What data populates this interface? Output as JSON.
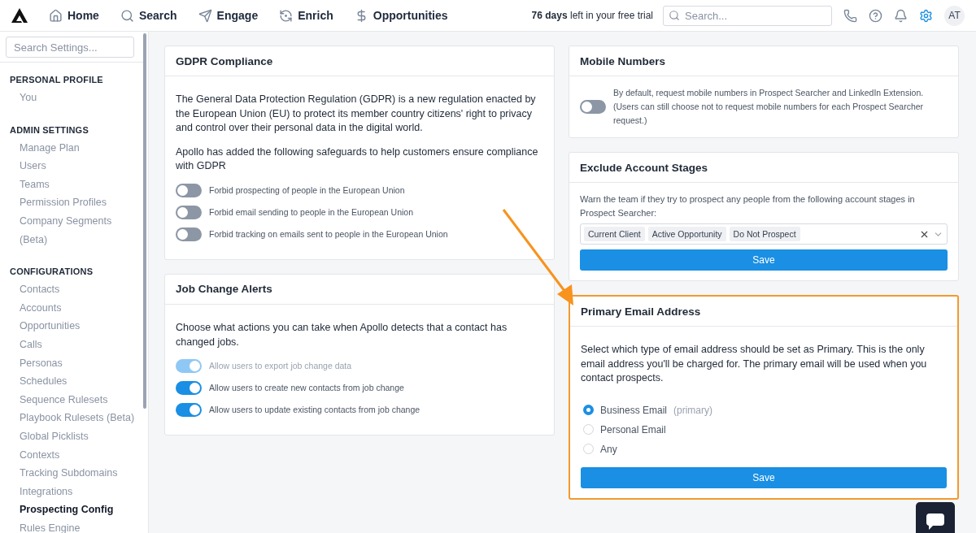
{
  "nav": {
    "items": [
      {
        "label": "Home"
      },
      {
        "label": "Search"
      },
      {
        "label": "Engage"
      },
      {
        "label": "Enrich"
      },
      {
        "label": "Opportunities"
      }
    ],
    "trial": "**76 days** left in your free trial",
    "search": {
      "placeholder": "Search..."
    },
    "settings_active": true,
    "avatar": "AT"
  },
  "sidebar": {
    "search": {
      "placeholder": "Search Settings..."
    },
    "sections": [
      {
        "heading": "PERSONAL PROFILE",
        "items": [
          {
            "label": "You",
            "selected": false
          }
        ]
      },
      {
        "heading": "ADMIN SETTINGS",
        "items": [
          {
            "label": "Manage Plan",
            "selected": false
          },
          {
            "label": "Users",
            "selected": false
          },
          {
            "label": "Teams",
            "selected": false
          },
          {
            "label": "Permission Profiles",
            "selected": false
          },
          {
            "label": "Company Segments (Beta)",
            "selected": false
          }
        ]
      },
      {
        "heading": "CONFIGURATIONS",
        "items": [
          {
            "label": "Contacts",
            "selected": false
          },
          {
            "label": "Accounts",
            "selected": false
          },
          {
            "label": "Opportunities",
            "selected": false
          },
          {
            "label": "Calls",
            "selected": false
          },
          {
            "label": "Personas",
            "selected": false
          },
          {
            "label": "Schedules",
            "selected": false
          },
          {
            "label": "Sequence Rulesets",
            "selected": false
          },
          {
            "label": "Playbook Rulesets (Beta)",
            "selected": false
          },
          {
            "label": "Global Picklists",
            "selected": false
          },
          {
            "label": "Contexts",
            "selected": false
          },
          {
            "label": "Tracking Subdomains",
            "selected": false
          },
          {
            "label": "Integrations",
            "selected": false
          },
          {
            "label": "Prospecting Config",
            "selected": true
          },
          {
            "label": "Rules Engine",
            "selected": false
          }
        ]
      }
    ]
  },
  "columns": [
    [
      {
        "title": "GDPR Compliance",
        "highlighted": false,
        "paragraphs": [
          "The General Data Protection Regulation (GDPR) is a new regulation enacted by the European Union (EU) to protect its member country citizens' right to privacy and control over their personal data in the digital world.",
          "Apollo has added the following safeguards to help customers ensure compliance with GDPR"
        ],
        "toggles": [
          {
            "label": "Forbid prospecting of people in the European Union",
            "on": false,
            "disabled": false
          },
          {
            "label": "Forbid email sending to people in the European Union",
            "on": false,
            "disabled": false
          },
          {
            "label": "Forbid tracking on emails sent to people in the European Union",
            "on": false,
            "disabled": false
          }
        ]
      },
      {
        "title": "Job Change Alerts",
        "highlighted": false,
        "paragraphs": [
          "Choose what actions you can take when Apollo detects that a contact has changed jobs."
        ],
        "toggles": [
          {
            "label": "Allow users to export job change data",
            "on": true,
            "disabled": true
          },
          {
            "label": "Allow users to create new contacts from job change",
            "on": true,
            "disabled": false
          },
          {
            "label": "Allow users to update existing contacts from job change",
            "on": true,
            "disabled": false
          }
        ]
      }
    ],
    [
      {
        "title": "Mobile Numbers",
        "highlighted": false,
        "inline_toggle": {
          "label": "By default, request mobile numbers in Prospect Searcher and LinkedIn Extension. (Users can still choose not to request mobile numbers for each Prospect Searcher request.)",
          "on": false,
          "disabled": false
        }
      },
      {
        "title": "Exclude Account Stages",
        "highlighted": false,
        "note": "Warn the team if they try to prospect any people from the following account stages in Prospect Searcher:",
        "tags": [
          "Current Client",
          "Active Opportunity",
          "Do Not Prospect"
        ],
        "button": "Save"
      },
      {
        "title": "Primary Email Address",
        "highlighted": true,
        "paragraphs": [
          "Select which type of email address should be set as Primary. This is the only email address you'll be charged for. The primary email will be used when you contact prospects."
        ],
        "radios": [
          {
            "label": "Business Email",
            "hint": "(primary)",
            "selected": true
          },
          {
            "label": "Personal Email",
            "selected": false
          },
          {
            "label": "Any",
            "selected": false
          }
        ],
        "button": "Save"
      }
    ]
  ]
}
